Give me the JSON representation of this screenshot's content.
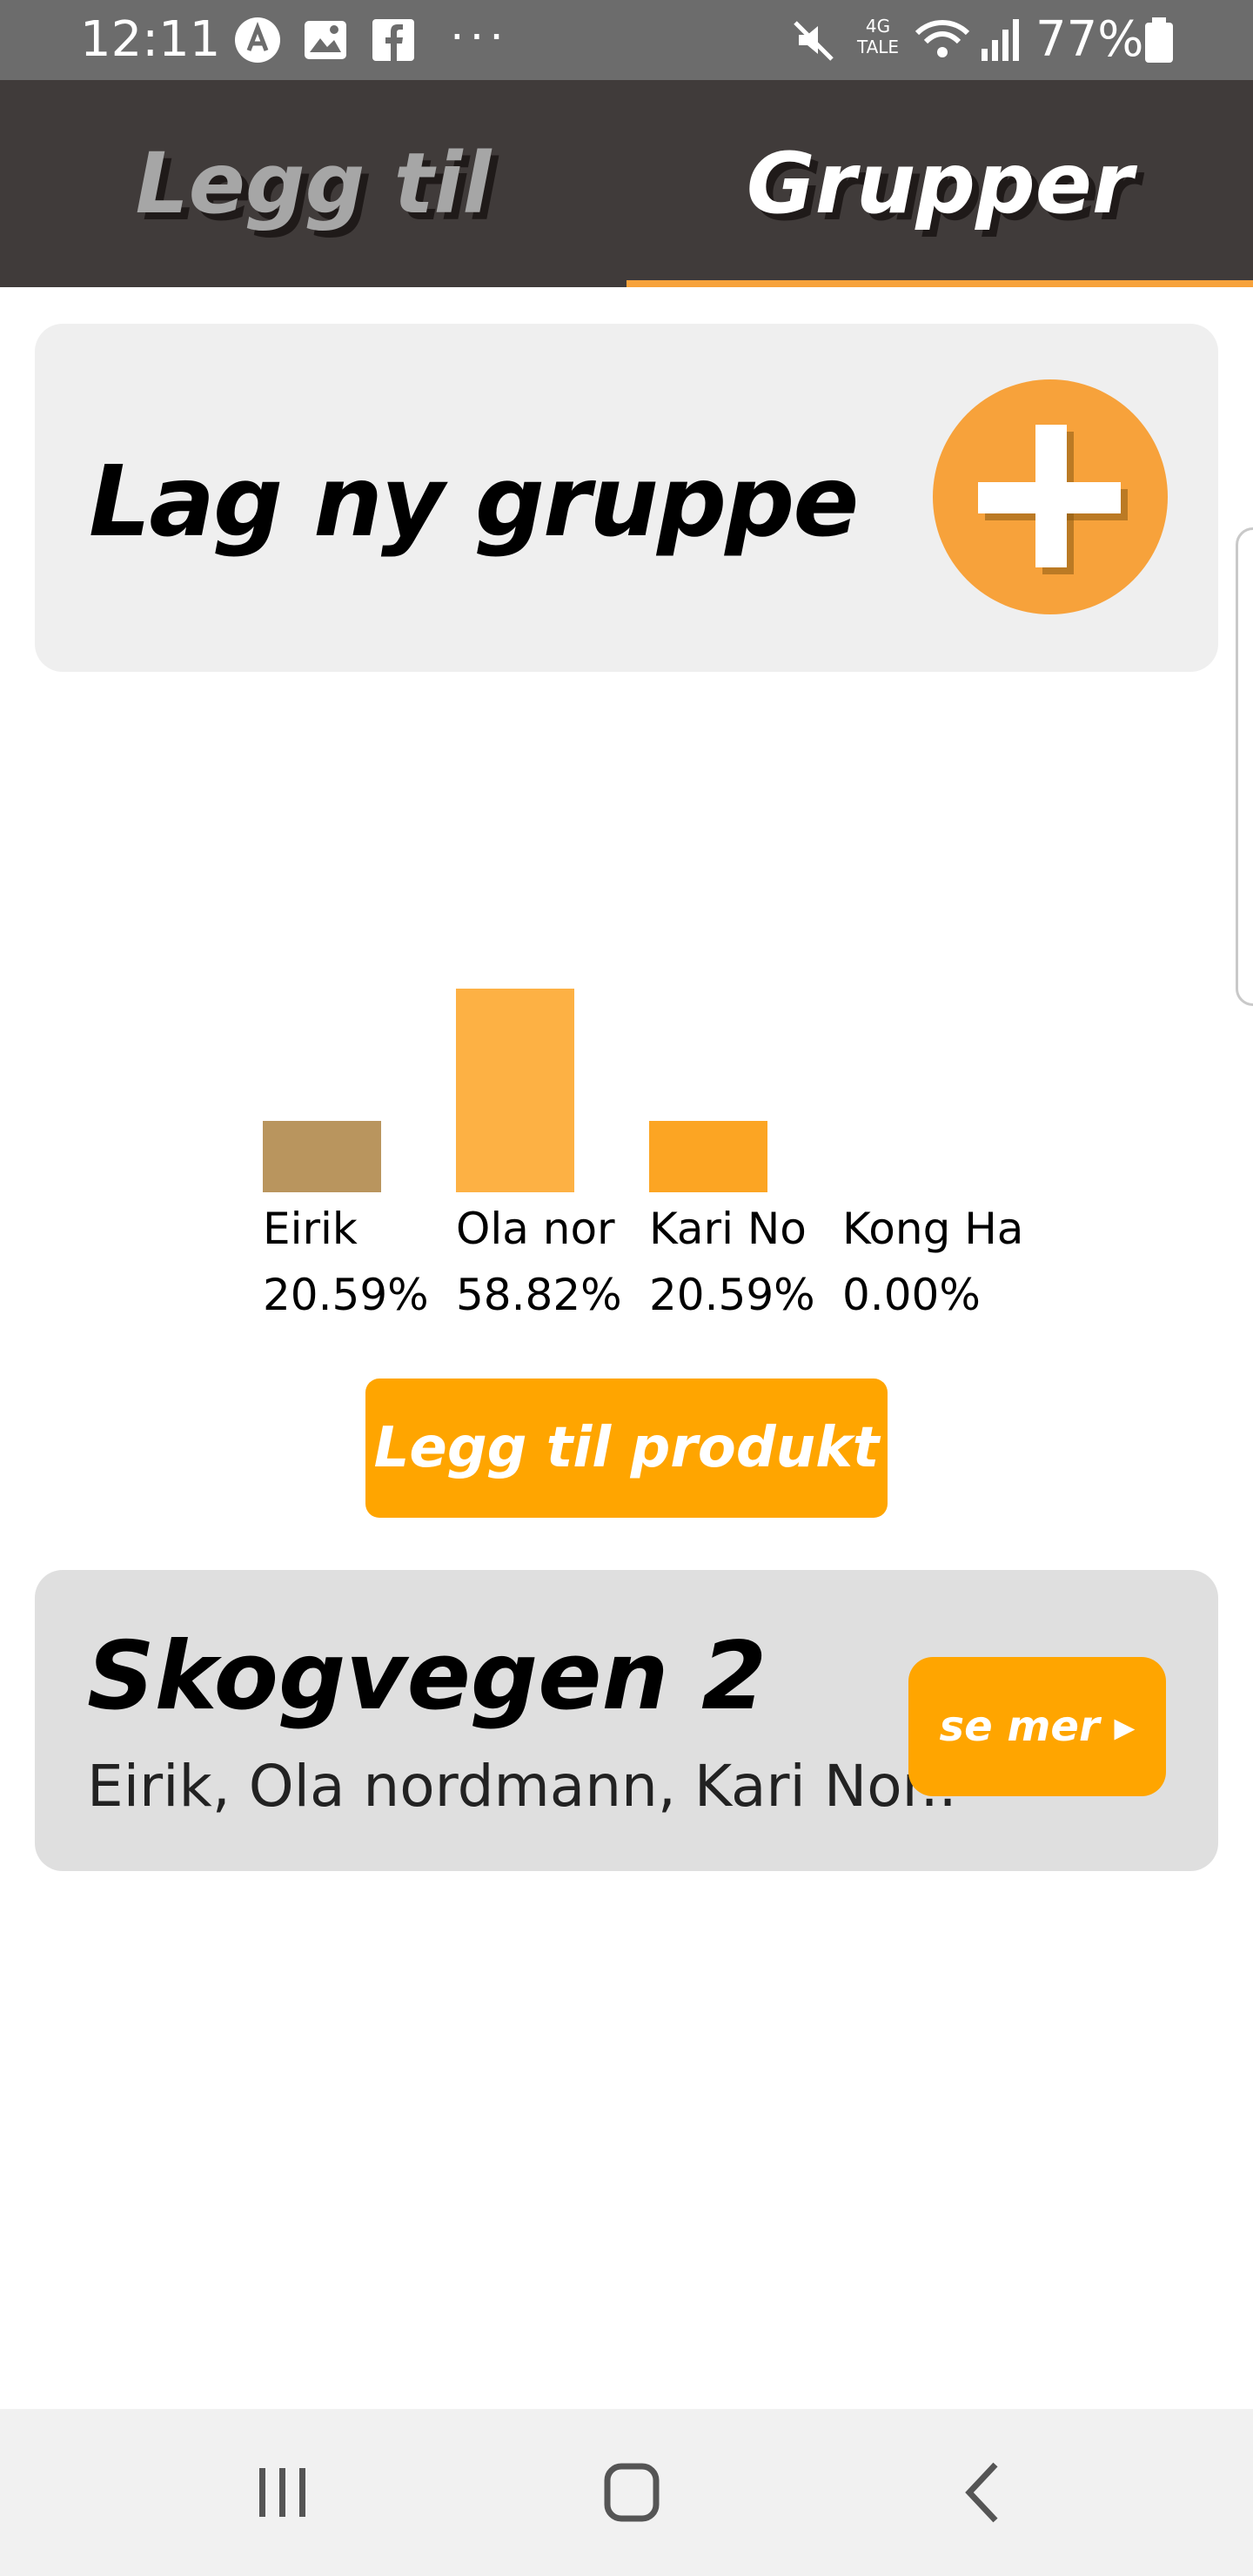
{
  "status_bar": {
    "time": "12:11",
    "network_type": "4G",
    "network_sub": "TALE",
    "battery": "77%",
    "more": "···",
    "icons": [
      "assistant-icon",
      "gallery-icon",
      "facebook-icon",
      "mute-icon",
      "wifi-icon",
      "signal-icon",
      "battery-icon"
    ]
  },
  "tabs": [
    {
      "label": "Legg til",
      "active": false
    },
    {
      "label": "Grupper",
      "active": true
    }
  ],
  "new_group": {
    "title": "Lag ny gruppe",
    "icon": "plus-icon"
  },
  "chart_data": {
    "type": "bar",
    "categories": [
      "Eirik",
      "Ola nor",
      "Kari No",
      "Kong Ha"
    ],
    "values": [
      20.59,
      58.82,
      20.59,
      0.0
    ],
    "value_labels": [
      "20.59%",
      "58.82%",
      "20.59%",
      "0.00%"
    ],
    "colors": [
      "#b9955e",
      "#fdb144",
      "#fca523",
      "#f7a23b"
    ],
    "ylim": [
      0,
      58.82
    ],
    "grid": false
  },
  "add_product_label": "Legg til produkt",
  "group": {
    "name": "Skogvegen 2",
    "members": "Eirik, Ola nordmann, Kari Nor..",
    "see_more": "se mer ▸"
  },
  "colors": {
    "accent": "#f7a23b",
    "button": "#ffa500",
    "tabbar": "#403b3a",
    "statusbar": "#6c6c6c"
  },
  "nav": {
    "icons": [
      "recent-apps-icon",
      "home-icon",
      "back-icon"
    ]
  }
}
